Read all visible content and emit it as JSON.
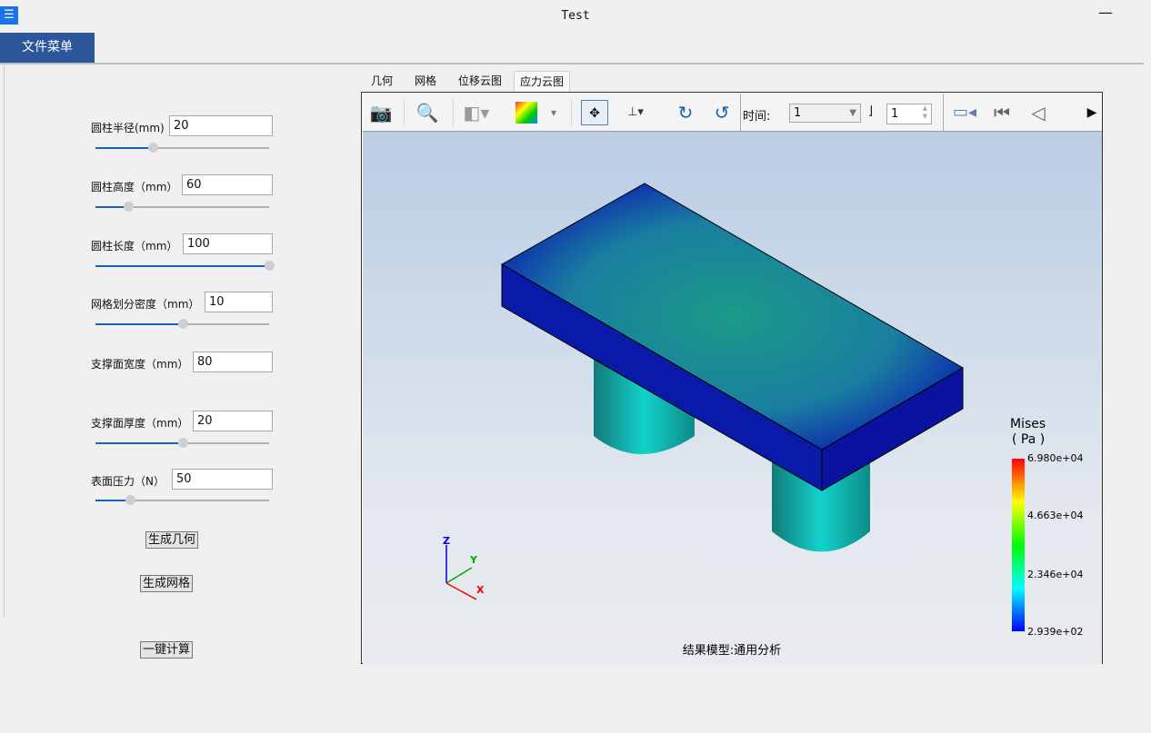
{
  "window": {
    "title": "Test",
    "minimize": "—"
  },
  "menu": {
    "file_menu": "文件菜单"
  },
  "params": [
    {
      "label": "圆柱半径(mm)",
      "value": "20",
      "slider": 0.33
    },
    {
      "label": "圆柱高度（mm）",
      "value": "60",
      "slider": 0.19
    },
    {
      "label": "圆柱长度（mm）",
      "value": "100",
      "slider": 1.0
    },
    {
      "label": "网格划分密度（mm）",
      "value": "10",
      "slider": 0.5
    },
    {
      "label": "支撑面宽度（mm）",
      "value": "80"
    },
    {
      "label": "支撑面厚度（mm）",
      "value": "20",
      "slider": 0.5
    },
    {
      "label": "表面压力（N）",
      "value": "50",
      "slider": 0.2
    }
  ],
  "buttons": {
    "gen_geometry": "生成几何",
    "gen_mesh": "生成网格",
    "compute": "一键计算"
  },
  "tabs": [
    "几何",
    "网格",
    "位移云图",
    "应力云图"
  ],
  "active_tab": "应力云图",
  "toolbar": {
    "time_label": "时间:",
    "time_value": "1",
    "step_value": "1"
  },
  "legend": {
    "title": "Mises",
    "unit": "( Pa )",
    "max": "6.980e+04",
    "v2": "4.663e+04",
    "v1": "2.346e+04",
    "min": "2.939e+02",
    "colors": [
      "#ff0000",
      "#ffff00",
      "#00ff00",
      "#00ffff",
      "#0000ff"
    ]
  },
  "axes": {
    "x": "X",
    "y": "Y",
    "z": "Z"
  },
  "caption": "结果模型:通用分析"
}
